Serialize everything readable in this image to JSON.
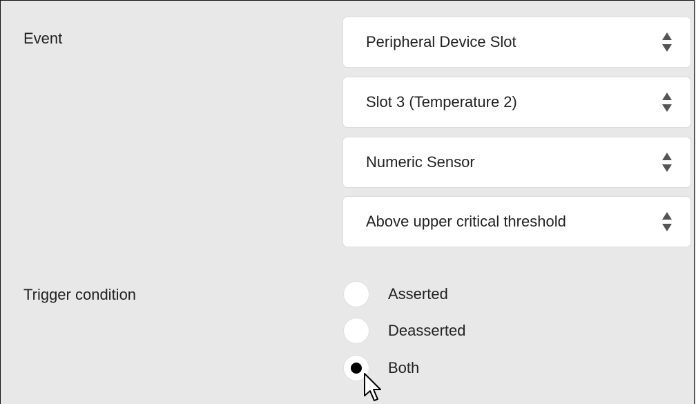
{
  "event": {
    "label": "Event",
    "selects": [
      {
        "value": "Peripheral Device Slot",
        "icon": "up-down-arrows-icon"
      },
      {
        "value": "Slot 3 (Temperature 2)",
        "icon": "up-down-arrows-icon"
      },
      {
        "value": "Numeric Sensor",
        "icon": "up-down-arrows-icon"
      },
      {
        "value": "Above upper critical threshold",
        "icon": "up-down-arrows-icon"
      }
    ]
  },
  "trigger": {
    "label": "Trigger condition",
    "options": [
      {
        "label": "Asserted",
        "checked": false
      },
      {
        "label": "Deasserted",
        "checked": false
      },
      {
        "label": "Both",
        "checked": true
      }
    ]
  },
  "cursor_icon": "mouse-pointer-icon"
}
